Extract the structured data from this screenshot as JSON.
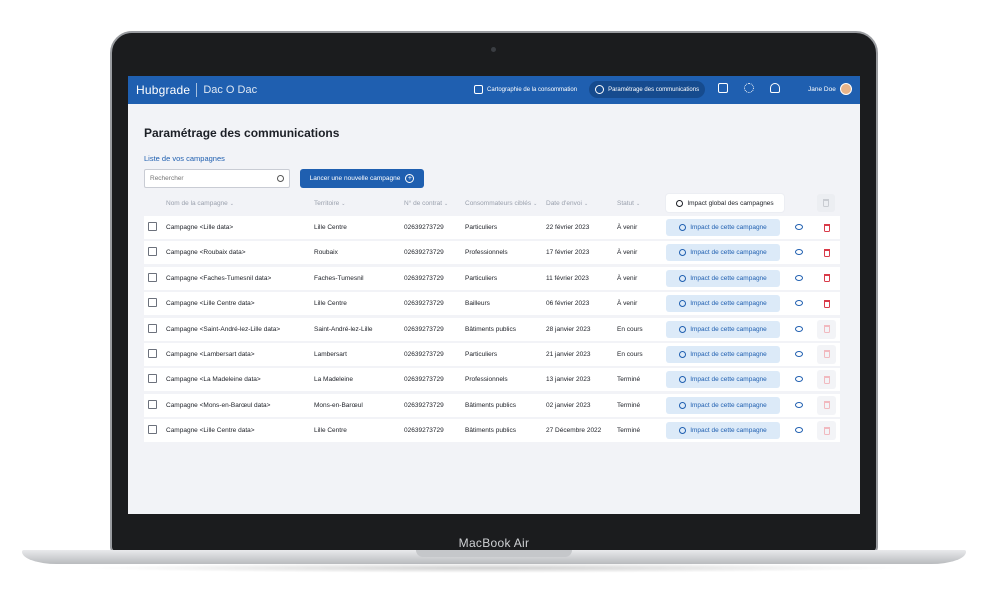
{
  "device": {
    "label": "MacBook Air"
  },
  "header": {
    "brand": "Hubgrade",
    "subbrand": "Dac O Dac",
    "nav": [
      {
        "label": "Cartographie de la consommation",
        "active": false
      },
      {
        "label": "Paramétrage des communications",
        "active": true
      }
    ],
    "user_name": "Jane Doe",
    "icons": [
      "mail-icon",
      "gear-icon",
      "bell-icon"
    ]
  },
  "page": {
    "title": "Paramétrage des communications",
    "list_title": "Liste de vos campagnes",
    "search_placeholder": "Rechercher",
    "new_campaign_label": "Lancer une nouvelle campagne",
    "impact_global_label": "Impact global des campagnes"
  },
  "table": {
    "headers": [
      "Nom de la campagne",
      "Territoire",
      "N° de contrat",
      "Consommateurs ciblés",
      "Date d'envoi",
      "Statut"
    ],
    "impact_label": "Impact de cette campagne",
    "rows": [
      {
        "name": "Campagne <Lille data>",
        "territory": "Lille Centre",
        "contract": "02639273729",
        "target": "Particuliers",
        "date": "22 février 2023",
        "status": "À venir",
        "deletable": true
      },
      {
        "name": "Campagne <Roubaix data>",
        "territory": "Roubaix",
        "contract": "02639273729",
        "target": "Professionnels",
        "date": "17 février 2023",
        "status": "À venir",
        "deletable": true
      },
      {
        "name": "Campagne <Faches-Tumesnil data>",
        "territory": "Faches-Tumesnil",
        "contract": "02639273729",
        "target": "Particuliers",
        "date": "11 février 2023",
        "status": "À venir",
        "deletable": true
      },
      {
        "name": "Campagne <Lille Centre data>",
        "territory": "Lille Centre",
        "contract": "02639273729",
        "target": "Bailleurs",
        "date": "06 février 2023",
        "status": "À venir",
        "deletable": true
      },
      {
        "name": "Campagne <Saint-André-lez-Lille data>",
        "territory": "Saint-André-lez-Lille",
        "contract": "02639273729",
        "target": "Bâtiments publics",
        "date": "28 janvier 2023",
        "status": "En cours",
        "deletable": false
      },
      {
        "name": "Campagne <Lambersart data>",
        "territory": "Lambersart",
        "contract": "02639273729",
        "target": "Particuliers",
        "date": "21 janvier 2023",
        "status": "En cours",
        "deletable": false
      },
      {
        "name": "Campagne <La Madeleine data>",
        "territory": "La Madeleine",
        "contract": "02639273729",
        "target": "Professionnels",
        "date": "13 janvier 2023",
        "status": "Terminé",
        "deletable": false
      },
      {
        "name": "Campagne <Mons-en-Barœul data>",
        "territory": "Mons-en-Barœul",
        "contract": "02639273729",
        "target": "Bâtiments publics",
        "date": "02 janvier 2023",
        "status": "Terminé",
        "deletable": false
      },
      {
        "name": "Campagne <Lille Centre data>",
        "territory": "Lille Centre",
        "contract": "02639273729",
        "target": "Bâtiments publics",
        "date": "27 Décembre 2022",
        "status": "Terminé",
        "deletable": false
      }
    ]
  }
}
